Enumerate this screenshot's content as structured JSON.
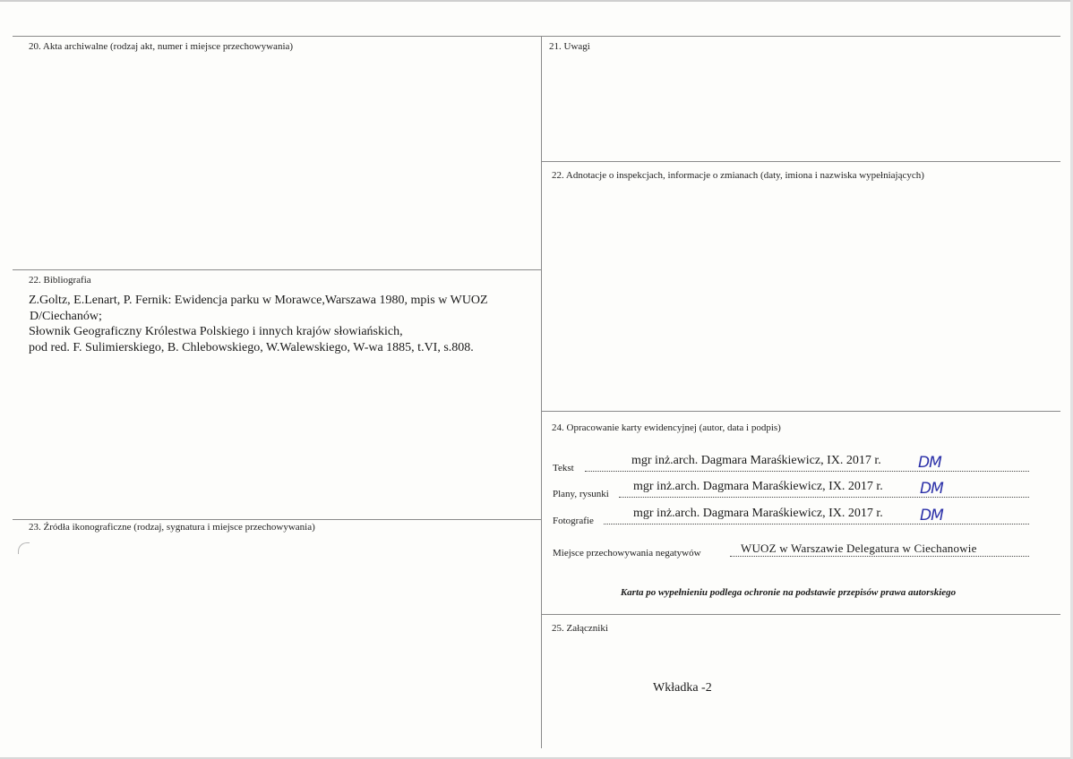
{
  "sections": {
    "s20": "20. Akta archiwalne (rodzaj akt, numer i miejsce przechowywania)",
    "s21": "21. Uwagi",
    "s22a": "22. Adnotacje o inspekcjach, informacje o zmianach (daty, imiona i nazwiska wypełniających)",
    "s22b": "22. Bibliografia",
    "s23": "23. Źródła ikonograficzne (rodzaj, sygnatura i miejsce przechowywania)",
    "s24": "24. Opracowanie karty ewidencyjnej (autor, data i podpis)",
    "s25": "25. Załączniki"
  },
  "bibliography": [
    "Z.Goltz, E.Lenart, P. Fernik: Ewidencja parku w Morawce,Warszawa 1980, mpis w WUOZ",
    "D/Ciechanów;",
    "Słownik Geograficzny Królestwa Polskiego i innych krajów słowiańskich,",
    "pod red. F. Sulimierskiego, B. Chlebowskiego, W.Walewskiego, W-wa 1885, t.VI, s.808."
  ],
  "authorship": {
    "rows": [
      {
        "label": "Tekst",
        "value": "mgr inż.arch. Dagmara Maraśkiewicz, IX. 2017 r.",
        "signature": "DM"
      },
      {
        "label": "Plany, rysunki",
        "value": "mgr inż.arch. Dagmara Maraśkiewicz, IX. 2017 r.",
        "signature": "DM"
      },
      {
        "label": "Fotografie",
        "value": "mgr inż.arch. Dagmara Maraśkiewicz, IX. 2017 r.",
        "signature": "DM"
      }
    ],
    "negatives_label": "Miejsce przechowywania negatywów",
    "negatives_value": "WUOZ w Warszawie Delegatura w Ciechanowie",
    "copyright_note": "Karta po wypełnieniu podlega ochronie na podstawie przepisów prawa autorskiego"
  },
  "attachments": {
    "item": "Wkładka -2"
  },
  "colors": {
    "signature_ink": "#2a2fa8",
    "rule": "#8a8a8a"
  }
}
